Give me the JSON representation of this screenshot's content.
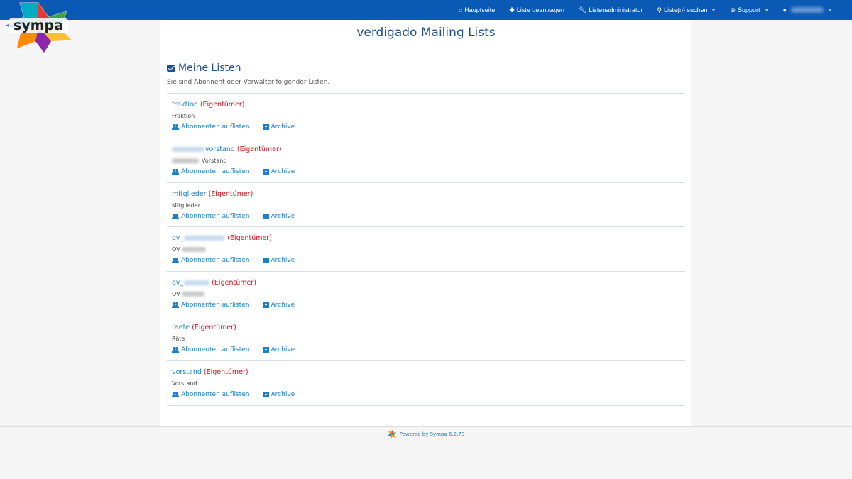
{
  "brand": {
    "logo_text": "sympa"
  },
  "nav": {
    "home": "Hauptseite",
    "request_list": "Liste beantragen",
    "list_admin": "Listenadministrator",
    "search_lists": "Liste(n) suchen",
    "support": "Support"
  },
  "page": {
    "title": "verdigado Mailing Lists",
    "section_title": "Meine Listen",
    "intro": "Sie sind Abonnent oder Verwalter folgender Listen."
  },
  "links": {
    "subscribers": "Abonnenten auflisten",
    "archive": "Archive"
  },
  "lists": [
    {
      "name": "fraktion",
      "role": "(Eigentümer)",
      "desc": "Fraktion"
    },
    {
      "name": "vorstand",
      "role": "(Eigentümer)",
      "desc": "Vorstand"
    },
    {
      "name": "mitglieder",
      "role": "(Eigentümer)",
      "desc": "Mitglieder"
    },
    {
      "name": "ov_",
      "role": "(Eigentümer)",
      "desc": "OV"
    },
    {
      "name": "ov_",
      "role": "(Eigentümer)",
      "desc": "OV"
    },
    {
      "name": "raete",
      "role": "(Eigentümer)",
      "desc": "Räte"
    },
    {
      "name": "vorstand",
      "role": "(Eigentümer)",
      "desc": "Vorstand"
    }
  ],
  "footer": {
    "powered_by": "Powered by Sympa 6.2.70"
  },
  "colors": {
    "topbar": "#0a5ab5",
    "link": "#1a7fd1",
    "role": "#d0111b",
    "heading": "#1d4f8c"
  }
}
